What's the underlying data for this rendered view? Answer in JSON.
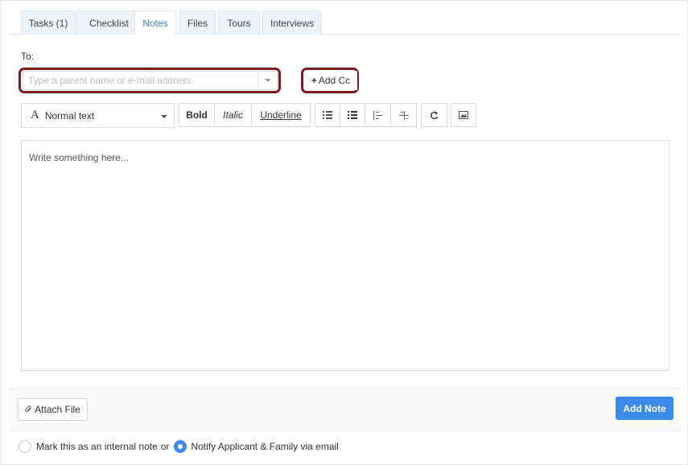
{
  "tabs": [
    {
      "label": "Tasks (1)",
      "active": false
    },
    {
      "label": "Checklist",
      "active": false
    },
    {
      "label": "Notes",
      "active": true
    },
    {
      "label": "Files",
      "active": false
    },
    {
      "label": "Tours",
      "active": false
    },
    {
      "label": "Interviews",
      "active": false
    }
  ],
  "to_label": "To:",
  "recipient": {
    "placeholder": "Type a parent name or e-mail address",
    "value": ""
  },
  "add_cc": {
    "icon": "plus-icon",
    "label": "Add Cc"
  },
  "toolbar": {
    "format_select": {
      "icon": "font-icon",
      "icon_glyph": "A",
      "value": "Normal text"
    },
    "bold": "Bold",
    "italic": "Italic",
    "underline": "Underline",
    "icons": [
      "bullet-list-icon",
      "numbered-list-icon",
      "outdent-icon",
      "indent-icon",
      "link-icon",
      "image-icon"
    ]
  },
  "editor": {
    "placeholder": "Write something here..."
  },
  "footer": {
    "attach": {
      "icon": "paperclip-icon",
      "label": "Attach File"
    },
    "add_note": "Add Note",
    "add_note_color": "#3b8ae8",
    "option_internal": {
      "label": "Mark this as an internal note",
      "selected": false
    },
    "connector": "or",
    "option_notify": {
      "label": "Notify Applicant & Family via email",
      "selected": true
    }
  },
  "colors": {
    "highlight": "#7b1c20",
    "accent": "#3b8ae8",
    "active_tab": "#4a86c8"
  }
}
